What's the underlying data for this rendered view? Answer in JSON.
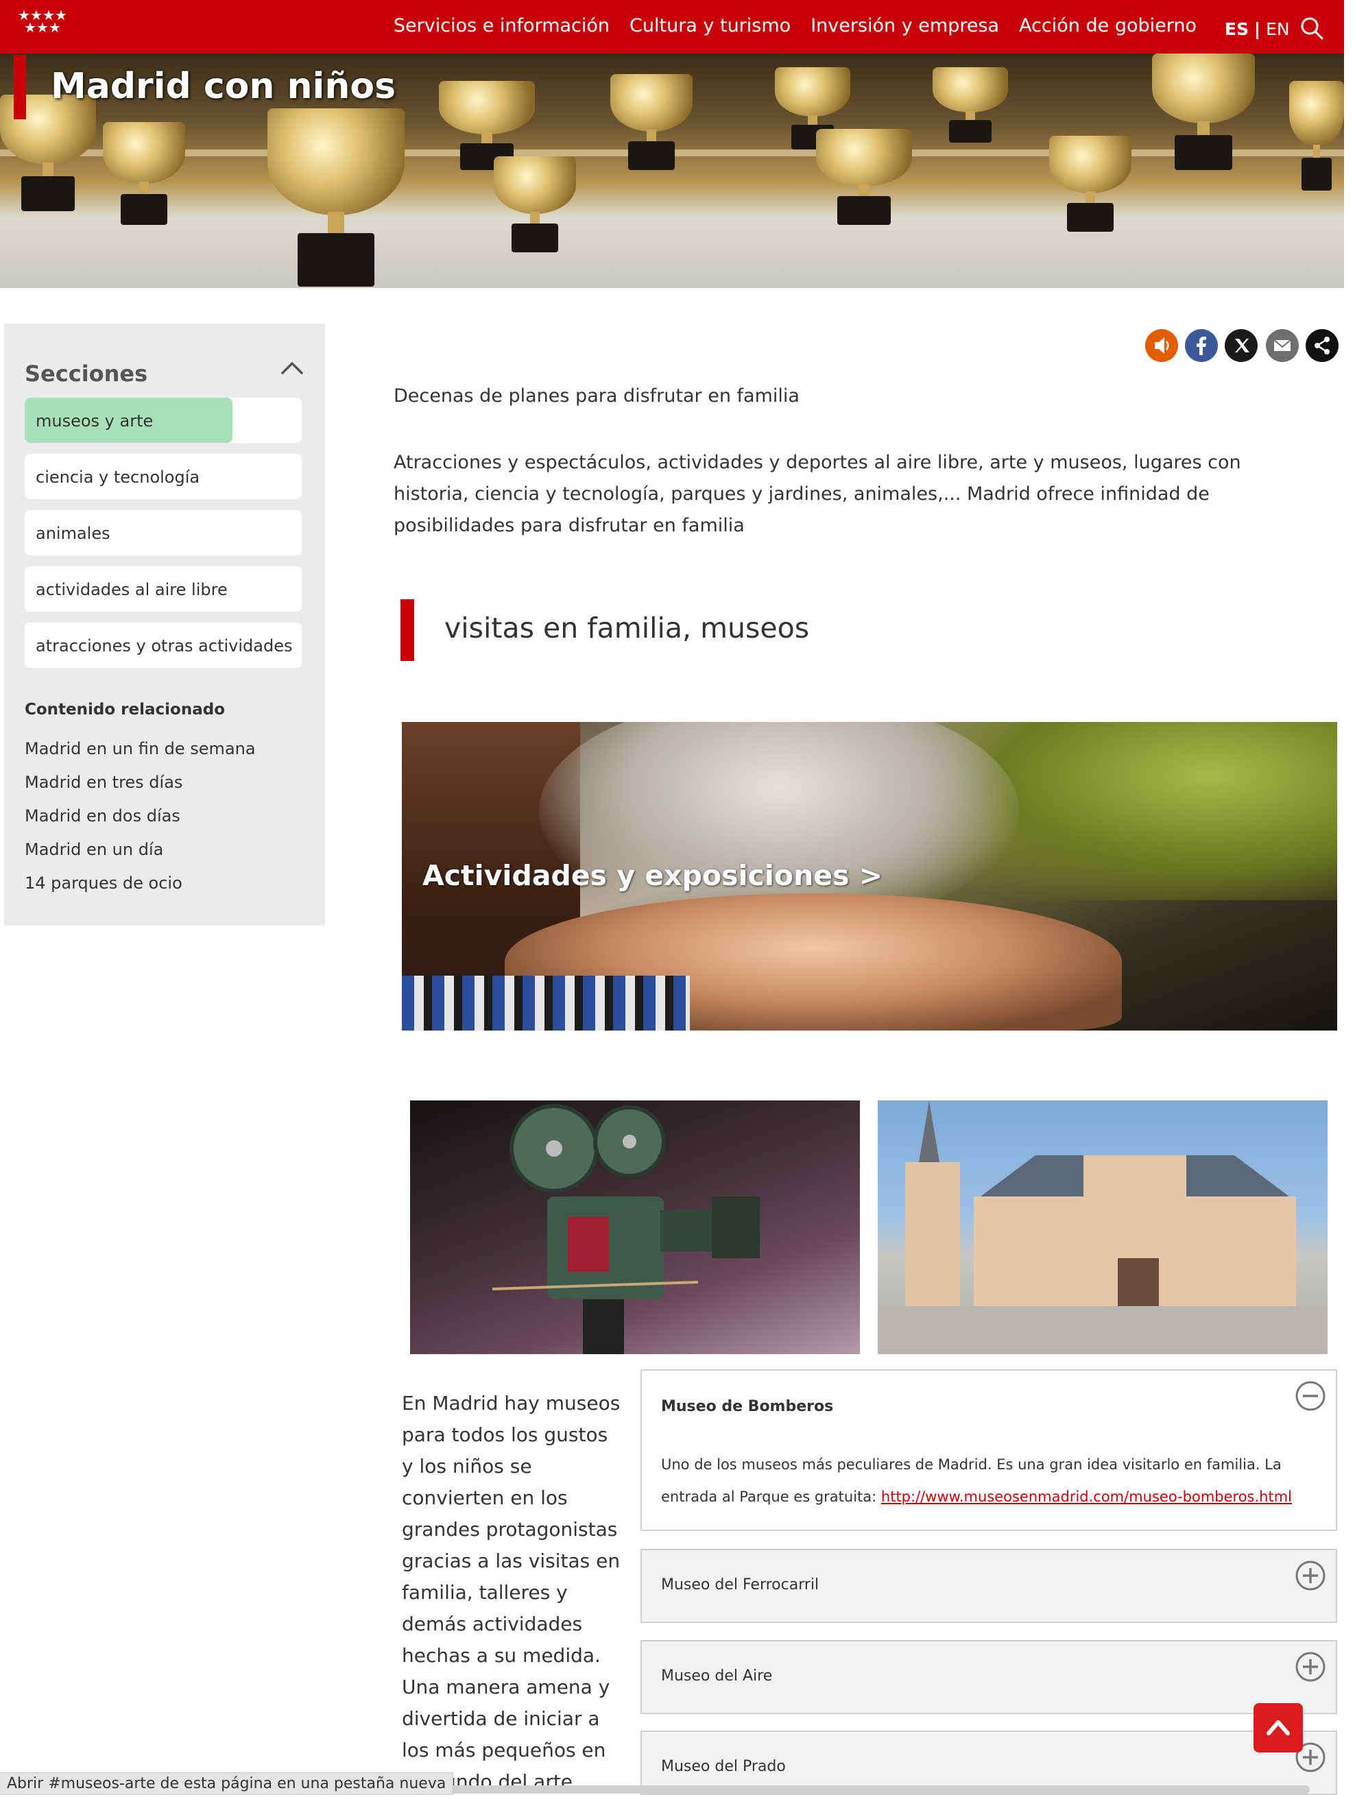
{
  "header": {
    "nav": [
      "Servicios e información",
      "Cultura y turismo",
      "Inversión y empresa",
      "Acción de gobierno"
    ],
    "lang_active": "ES",
    "lang_sep": "|",
    "lang_other": "EN",
    "brand_color": "#c8000a"
  },
  "hero": {
    "title": "Madrid con niños"
  },
  "sidebar": {
    "title": "Secciones",
    "items": [
      {
        "label": "museos y arte",
        "progress": 0.75
      },
      {
        "label": "ciencia y tecnología"
      },
      {
        "label": "animales"
      },
      {
        "label": "actividades al aire libre"
      },
      {
        "label": "atracciones y otras actividades"
      }
    ],
    "related_title": "Contenido relacionado",
    "related": [
      "Madrid en un fin de semana",
      "Madrid en tres días",
      "Madrid en dos días",
      "Madrid en un día",
      "14 parques de ocio"
    ]
  },
  "share": {
    "icons": [
      "audio-icon",
      "facebook-icon",
      "x-twitter-icon",
      "email-icon",
      "share-icon"
    ],
    "colors": {
      "audio": "#e25c00",
      "facebook": "#3b5998",
      "x": "#1a1a1a",
      "email": "#6e6e6e",
      "share": "#111111"
    }
  },
  "main": {
    "intro1": "Decenas de planes para disfrutar en familia",
    "intro2": "Atracciones y espectáculos, actividades y deportes al aire libre, arte y museos, lugares con historia, ciencia y tecnología, parques y jardines, animales,... Madrid ofrece infinidad de posibilidades para disfrutar en familia",
    "section_title": "visitas en familia, museos",
    "feature_label": "Actividades y exposiciones >",
    "museos_text": "En Madrid hay museos para todos los gustos y los niños se convierten en los grandes protagonistas gracias a las visitas en familia, talleres y demás actividades hechas a su medida.  Una manera amena y divertida de iniciar a los más pequeños en el mundo del arte."
  },
  "accordion": [
    {
      "title": "Museo de Bomberos",
      "open": true,
      "body": "Uno de los museos más peculiares de Madrid. Es una gran idea visitarlo en familia. La entrada al Parque es gratuita: ",
      "link": "http://www.museosenmadrid.com/museo-bomberos.html"
    },
    {
      "title": "Museo del Ferrocarril",
      "open": false
    },
    {
      "title": "Museo del Aire",
      "open": false
    },
    {
      "title": "Museo del Prado",
      "open": false
    }
  ],
  "status_bar": "Abrir #museos-arte de esta página en una pestaña nueva"
}
